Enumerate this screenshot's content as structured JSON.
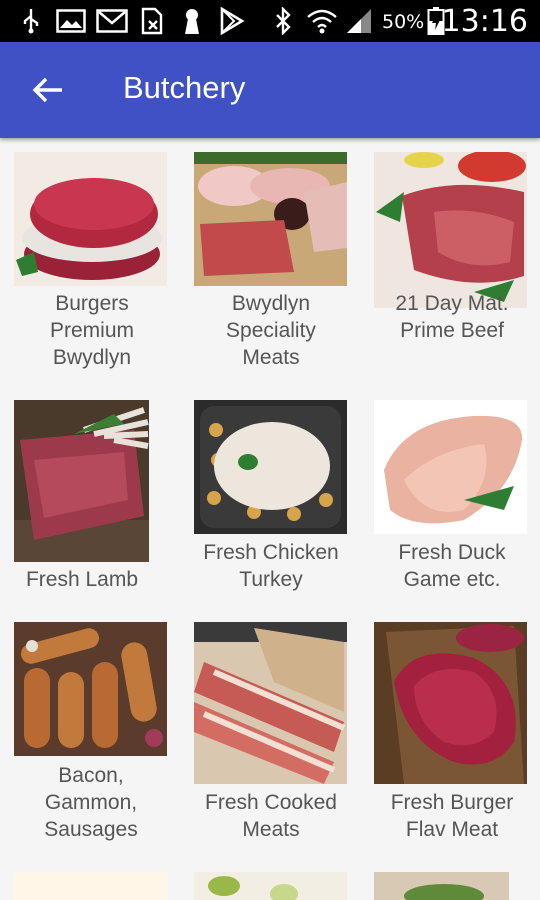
{
  "status_bar": {
    "battery_percent": "50%",
    "time": "13:16"
  },
  "app_bar": {
    "title": "Butchery",
    "back_icon": "arrow-back-icon"
  },
  "categories": [
    {
      "label": "Burgers\nPremium\nBwydlyn"
    },
    {
      "label": "Bwydlyn\nSpeciality\nMeats"
    },
    {
      "label": "21 Day Mat.\nPrime Beef"
    },
    {
      "label": "Fresh Lamb"
    },
    {
      "label": "Fresh Chicken\nTurkey"
    },
    {
      "label": "Fresh Duck\nGame etc."
    },
    {
      "label": "Bacon,\nGammon,\nSausages"
    },
    {
      "label": "Fresh Cooked\nMeats"
    },
    {
      "label": "Fresh Burger\nFlav Meat"
    }
  ],
  "colors": {
    "app_bar": "#3f51c5",
    "status_bar": "#000000",
    "background": "#f5f5f5",
    "label_text": "#555555"
  }
}
